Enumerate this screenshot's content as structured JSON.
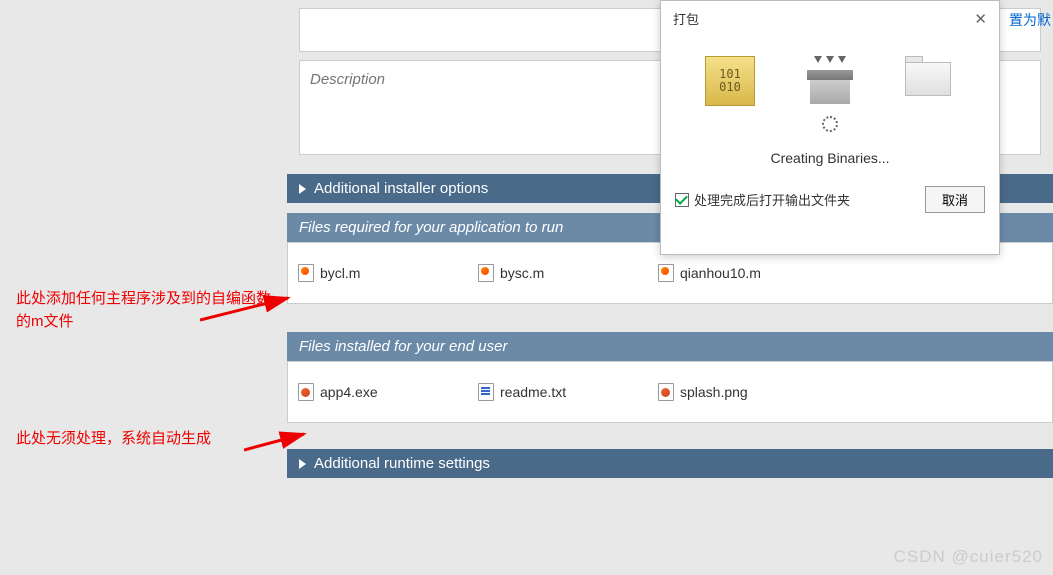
{
  "top": {
    "desc_placeholder": "Description",
    "link_label": "置为默"
  },
  "sections": {
    "installer_options": "Additional installer options",
    "files_required": "Files required for your application to run",
    "files_installed": "Files installed for your end user",
    "runtime_settings": "Additional runtime settings"
  },
  "required_files": [
    {
      "name": "bycl.m"
    },
    {
      "name": "bysc.m"
    },
    {
      "name": "qianhou10.m"
    }
  ],
  "installed_files": [
    {
      "name": "app4.exe",
      "type": "app"
    },
    {
      "name": "readme.txt",
      "type": "txt"
    },
    {
      "name": "splash.png",
      "type": "app"
    }
  ],
  "annotations": {
    "note1": "此处添加任何主程序涉及到的自编函数的m文件",
    "note2": "此处无须处理，系统自动生成"
  },
  "dialog": {
    "title": "打包",
    "status": "Creating Binaries...",
    "checkbox_label": "处理完成后打开输出文件夹",
    "cancel": "取消"
  },
  "watermark": "CSDN @cuier520"
}
